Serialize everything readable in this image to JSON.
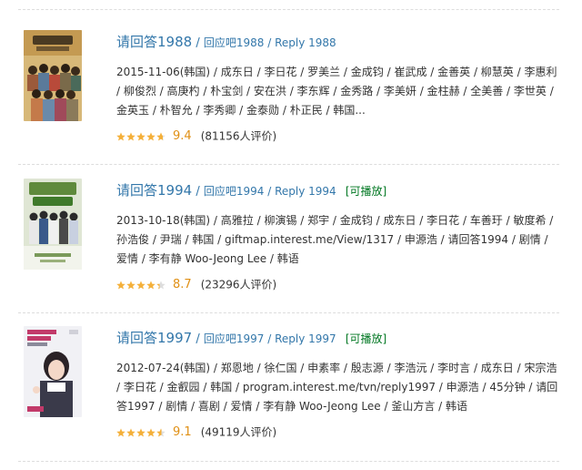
{
  "results": [
    {
      "title": "请回答1988",
      "separator": "/",
      "subtitle": "回应吧1988 / Reply 1988",
      "playable_label": "",
      "meta": "2015-11-06(韩国) / 成东日 / 李日花 / 罗美兰 / 金成钧 / 崔武成 / 金善英 / 柳慧英 / 李惠利 / 柳俊烈 / 高庚杓 / 朴宝剑 / 安在洪 / 李东辉 / 金秀路 / 李美妍 / 金柱赫 / 全美善 / 李世英 / 金英玉 / 朴智允 / 李秀卿 / 金泰勋 / 朴正民 / 韩国...",
      "rating": 9.4,
      "score": "9.4",
      "count": "(81156人评价)",
      "stars_icon": "rating-stars-icon",
      "poster_colors": [
        "#c49a52",
        "#8a6a3a",
        "#5a4a30"
      ]
    },
    {
      "title": "请回答1994",
      "separator": "/",
      "subtitle": "回应吧1994 / Reply 1994",
      "playable_label": "[可播放]",
      "meta": "2013-10-18(韩国) / 高雅拉 / 柳演锡 / 郑宇 / 金成钧 / 成东日 / 李日花 / 车善玗 / 敏度希 / 孙浩俊 / 尹瑞 / 韩国 / giftmap.interest.me/View/1317 / 申源浩 / 请回答1994 / 剧情 / 爱情 / 李有静 Woo-Jeong Lee / 韩语",
      "rating": 8.7,
      "score": "8.7",
      "count": "(23296人评价)",
      "stars_icon": "rating-stars-icon",
      "poster_colors": [
        "#b8c9a0",
        "#5f8a3c",
        "#2f4a22"
      ]
    },
    {
      "title": "请回答1997",
      "separator": "/",
      "subtitle": "回应吧1997 / Reply 1997",
      "playable_label": "[可播放]",
      "meta": "2012-07-24(韩国) / 郑恩地 / 徐仁国 / 申素率 / 殷志源 / 李浩沅 / 李时言 / 成东日 / 宋宗浩 / 李日花 / 金叡园 / 韩国 / program.interest.me/tvn/reply1997 / 申源浩 / 45分钟 / 请回答1997 / 剧情 / 喜剧 / 爱情 / 李有静 Woo-Jeong Lee / 釜山方言 / 韩语",
      "rating": 9.1,
      "score": "9.1",
      "count": "(49119人评价)",
      "stars_icon": "rating-stars-icon",
      "poster_colors": [
        "#e8e8ef",
        "#c23a6a",
        "#3a3a4a"
      ]
    }
  ],
  "colors": {
    "link": "#3377aa",
    "playable": "#007722",
    "score": "#e09015",
    "star": "#f4b03a",
    "star_empty": "#dddddd",
    "divider": "#dddddd"
  }
}
